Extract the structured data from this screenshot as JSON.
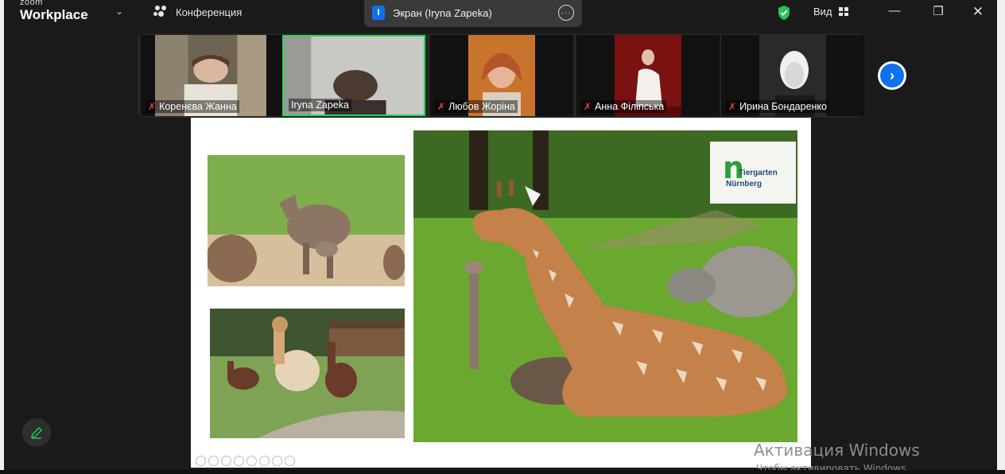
{
  "app": {
    "logo_small": "zoom",
    "logo_big": "Workplace"
  },
  "toolbar": {
    "meeting_label": "Конференция",
    "share_label": "Экран (Iryna Zapeka)",
    "view_label": "Вид"
  },
  "participants": [
    {
      "name": "Коренєва Жанна",
      "muted": true,
      "active": false
    },
    {
      "name": "Iryna Zapeka",
      "muted": false,
      "active": true
    },
    {
      "name": "Любов Жоріна",
      "muted": true,
      "active": false
    },
    {
      "name": "Анна Філіпська",
      "muted": true,
      "active": false
    },
    {
      "name": "Ирина Бондаренко",
      "muted": true,
      "active": false
    }
  ],
  "slide": {
    "logo_line1": "Tiergarten",
    "logo_line2": "Nürnberg"
  },
  "watermark": {
    "line1": "Активация Windows",
    "line2": "Чтобы активировать Windows"
  },
  "colors": {
    "accent": "#0e72ed",
    "active_border": "#23d959",
    "muted_icon": "#e8433a",
    "shield": "#23c552"
  }
}
